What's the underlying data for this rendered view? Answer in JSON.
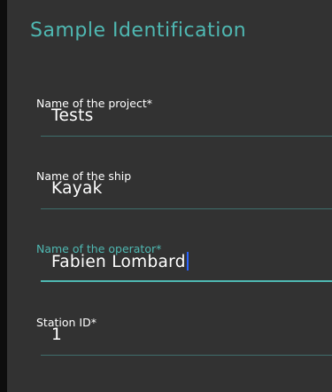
{
  "screen": {
    "title": "Sample Identification"
  },
  "fields": [
    {
      "label": "Name of the project*",
      "value": "Tests"
    },
    {
      "label": "Name of the ship",
      "value": "Kayak"
    },
    {
      "label": "Name of the operator*",
      "value": "Fabien Lombard",
      "focused": true
    },
    {
      "label": "Station ID*",
      "value": "1"
    }
  ],
  "colors": {
    "accent": "#4fb8b2",
    "background": "#323232",
    "caret": "#2a63ff",
    "underline": "#3f6e6c",
    "text": "#ffffff"
  }
}
